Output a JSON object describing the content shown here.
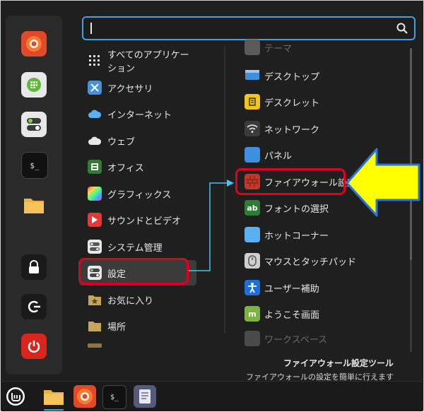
{
  "search": {
    "value": ""
  },
  "categories": [
    {
      "label": "すべてのアプリケーション",
      "icon": "grid-icon"
    },
    {
      "label": "アクセサリ",
      "icon": "scissors-icon"
    },
    {
      "label": "インターネット",
      "icon": "cloud-icon"
    },
    {
      "label": "ウェブ",
      "icon": "cloud-web-icon"
    },
    {
      "label": "オフィス",
      "icon": "office-icon"
    },
    {
      "label": "グラフィックス",
      "icon": "graphics-icon"
    },
    {
      "label": "サウンドとビデオ",
      "icon": "play-icon"
    },
    {
      "label": "システム管理",
      "icon": "system-icon"
    },
    {
      "label": "設定",
      "icon": "settings-icon"
    },
    {
      "label": "お気に入り",
      "icon": "star-folder-icon"
    },
    {
      "label": "場所",
      "icon": "folder-icon"
    }
  ],
  "apps": [
    {
      "label": "テーマ",
      "icon": "theme-icon"
    },
    {
      "label": "デスクトップ",
      "icon": "desktop-icon"
    },
    {
      "label": "デスクレット",
      "icon": "desklet-icon"
    },
    {
      "label": "ネットワーク",
      "icon": "wifi-icon"
    },
    {
      "label": "パネル",
      "icon": "panel-icon"
    },
    {
      "label": "ファイアウォール設定",
      "icon": "firewall-icon"
    },
    {
      "label": "フォントの選択",
      "icon": "font-icon"
    },
    {
      "label": "ホットコーナー",
      "icon": "hotcorner-icon"
    },
    {
      "label": "マウスとタッチパッド",
      "icon": "mouse-icon"
    },
    {
      "label": "ユーザー補助",
      "icon": "accessibility-icon"
    },
    {
      "label": "ようこそ画面",
      "icon": "welcome-icon"
    },
    {
      "label": "ワークスペース",
      "icon": "workspace-icon"
    }
  ],
  "description": {
    "title": "ファイアウォール設定ツール",
    "subtitle": "ファイアウォールの設定を簡単に行えます"
  },
  "favorites": [
    "firefox-icon",
    "calculator-icon",
    "toggle-settings-icon",
    "terminal-icon",
    "folder-icon",
    "lock-icon",
    "logout-icon",
    "power-icon"
  ],
  "taskbar": [
    "mint-menu-icon",
    "files-icon",
    "firefox-icon",
    "terminal-icon",
    "text-editor-icon"
  ],
  "colors": {
    "accent": "#3ea2e4",
    "highlight": "#e0001b",
    "arrow": "#ffff00"
  }
}
